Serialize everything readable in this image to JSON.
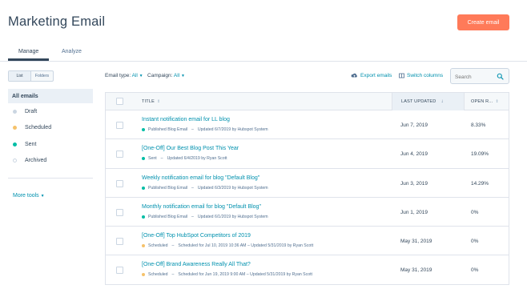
{
  "header": {
    "title": "Marketing Email",
    "create_label": "Create email"
  },
  "tabs": [
    {
      "label": "Manage"
    },
    {
      "label": "Analyze"
    }
  ],
  "sidebar": {
    "view_toggle": [
      "List",
      "Folders"
    ],
    "all_label": "All emails",
    "items": [
      {
        "label": "Draft",
        "color": "#cbd6e2"
      },
      {
        "label": "Scheduled",
        "color": "#f5c26b"
      },
      {
        "label": "Sent",
        "color": "#00bda5"
      },
      {
        "label": "Archived",
        "color": "#ffffff"
      }
    ],
    "more_tools": "More tools"
  },
  "filters": {
    "type_label": "Email type:",
    "type_value": "All",
    "campaign_label": "Campaign:",
    "campaign_value": "All"
  },
  "actions": {
    "export_label": "Export emails",
    "switch_label": "Switch columns"
  },
  "search": {
    "placeholder": "Search"
  },
  "table": {
    "columns": [
      "TITLE",
      "LAST UPDATED",
      "OPEN R..."
    ],
    "rows": [
      {
        "title": "Instant notification email for LL blog",
        "status": "Published Blog Email",
        "status_color": "#00bda5",
        "updated": "Updated 6/7/2019 by Hubspot System",
        "date": "Jun 7, 2019",
        "rate": "8.33%"
      },
      {
        "title": "[One-Off] Our Best Blog Post This Year",
        "status": "Sent",
        "status_color": "#00bda5",
        "updated": "Updated 6/4/2019 by Ryan Scott",
        "date": "Jun 4, 2019",
        "rate": "19.09%"
      },
      {
        "title": "Weekly notification email for blog \"Default Blog\"",
        "status": "Published Blog Email",
        "status_color": "#00bda5",
        "updated": "Updated 6/3/2019 by Hubspot System",
        "date": "Jun 3, 2019",
        "rate": "14.29%"
      },
      {
        "title": "Monthly notification email for blog \"Default Blog\"",
        "status": "Published Blog Email",
        "status_color": "#00bda5",
        "updated": "Updated 6/1/2019 by Hubspot System",
        "date": "Jun 1, 2019",
        "rate": "0%"
      },
      {
        "title": "[One-Off] Top HubSpot Competitors of 2019",
        "status": "Scheduled",
        "status_color": "#f5c26b",
        "updated": "Scheduled for Jul 10, 2019 10:36 AM – Updated 5/31/2019 by Ryan Scott",
        "date": "May 31, 2019",
        "rate": "0%"
      },
      {
        "title": "[One-Off] Brand Awareness Really All That?",
        "status": "Scheduled",
        "status_color": "#f5c26b",
        "updated": "Scheduled for Jun 19, 2019 9:00 AM – Updated 5/31/2019 by Ryan Scott",
        "date": "May 31, 2019",
        "rate": "0%"
      }
    ]
  }
}
